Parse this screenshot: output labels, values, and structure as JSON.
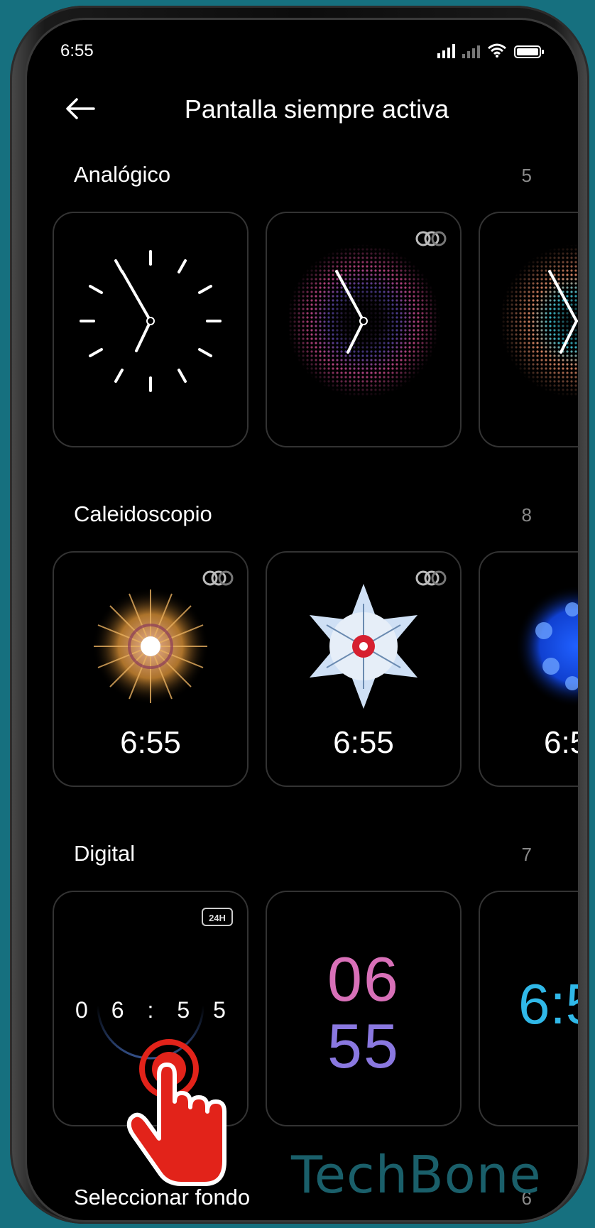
{
  "status_bar": {
    "time": "6:55"
  },
  "header": {
    "title": "Pantalla siempre activa"
  },
  "sections": [
    {
      "title": "Analógico",
      "count": "5"
    },
    {
      "title": "Caleidoscopio",
      "count": "8",
      "card_times": [
        "6:55",
        "6:55",
        "6:5"
      ]
    },
    {
      "title": "Digital",
      "count": "7"
    },
    {
      "title": "Seleccionar fondo",
      "count": "6"
    }
  ],
  "digital": {
    "card1_digits": [
      "0",
      "6",
      ":",
      "5",
      "5"
    ],
    "card1_badge": "24H",
    "card2_hour": "06",
    "card2_minute": "55",
    "card3_time": "6:5"
  },
  "watermark": "TechBone",
  "colors": {
    "background": "#16707f",
    "screen": "#000000",
    "card_border": "#333333",
    "count_text": "#8a8a8a",
    "accent_red": "#e2231a"
  }
}
